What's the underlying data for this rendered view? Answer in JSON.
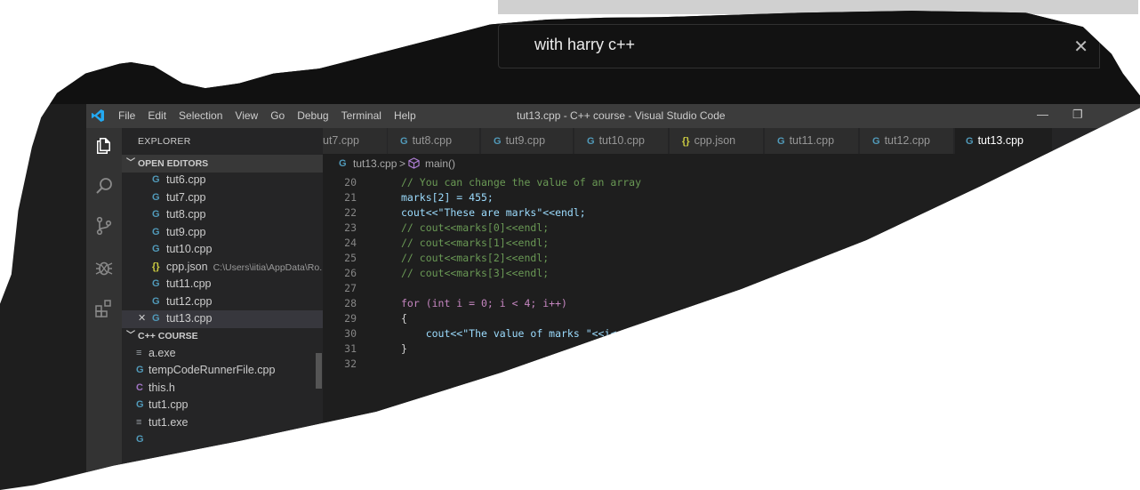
{
  "search": {
    "query": "with harry c++"
  },
  "titlebar": {
    "menu": [
      "File",
      "Edit",
      "Selection",
      "View",
      "Go",
      "Debug",
      "Terminal",
      "Help"
    ],
    "window_title": "tut13.cpp - C++ course - Visual Studio Code",
    "controls": {
      "minimize": "—",
      "restore": "❐"
    }
  },
  "sidebar": {
    "title": "EXPLORER",
    "open_editors": {
      "label": "OPEN EDITORS",
      "items": [
        {
          "icon": "G",
          "name": "tut6.cpp"
        },
        {
          "icon": "G",
          "name": "tut7.cpp"
        },
        {
          "icon": "G",
          "name": "tut8.cpp"
        },
        {
          "icon": "G",
          "name": "tut9.cpp"
        },
        {
          "icon": "G",
          "name": "tut10.cpp"
        },
        {
          "icon": "{}",
          "name": "cpp.json",
          "path": "C:\\Users\\iitia\\AppData\\Ro..."
        },
        {
          "icon": "G",
          "name": "tut11.cpp"
        },
        {
          "icon": "G",
          "name": "tut12.cpp"
        },
        {
          "icon": "G",
          "name": "tut13.cpp",
          "close": "✕"
        }
      ]
    },
    "project": {
      "label": "C++ COURSE",
      "items": [
        {
          "icon": "≡",
          "name": "a.exe"
        },
        {
          "icon": "G",
          "name": "tempCodeRunnerFile.cpp"
        },
        {
          "icon": "C",
          "name": "this.h"
        },
        {
          "icon": "G",
          "name": "tut1.cpp"
        },
        {
          "icon": "≡",
          "name": "tut1.exe"
        },
        {
          "icon": "G",
          "name": ""
        }
      ]
    }
  },
  "tabs": [
    {
      "icon": "",
      "label": "ut7.cpp"
    },
    {
      "icon": "G",
      "label": "tut8.cpp"
    },
    {
      "icon": "G",
      "label": "tut9.cpp"
    },
    {
      "icon": "G",
      "label": "tut10.cpp"
    },
    {
      "icon": "{}",
      "label": "cpp.json"
    },
    {
      "icon": "G",
      "label": "tut11.cpp"
    },
    {
      "icon": "G",
      "label": "tut12.cpp"
    },
    {
      "icon": "G",
      "label": "tut13.cpp"
    }
  ],
  "breadcrumb": {
    "file": "tut13.cpp",
    "sep": ">",
    "symbol": "main()"
  },
  "editor": {
    "lines": [
      {
        "n": "20",
        "text": "// You can change the value of an array"
      },
      {
        "n": "21",
        "text": "marks[2] = 455;"
      },
      {
        "n": "22",
        "text": "cout<<\"These are marks\"<<endl;"
      },
      {
        "n": "23",
        "text": "// cout<<marks[0]<<endl;"
      },
      {
        "n": "24",
        "text": "// cout<<marks[1]<<endl;"
      },
      {
        "n": "25",
        "text": "// cout<<marks[2]<<endl;"
      },
      {
        "n": "26",
        "text": "// cout<<marks[3]<<endl;"
      },
      {
        "n": "27",
        "text": ""
      },
      {
        "n": "28",
        "text": "for (int i = 0; i < 4; i++)"
      },
      {
        "n": "29",
        "text": "{"
      },
      {
        "n": "30",
        "text": "    cout<<\"The value of marks \"<<i<<\" is \"<<marks[i]<<endl;"
      },
      {
        "n": "31",
        "text": "}"
      },
      {
        "n": "32",
        "text": ""
      }
    ]
  }
}
